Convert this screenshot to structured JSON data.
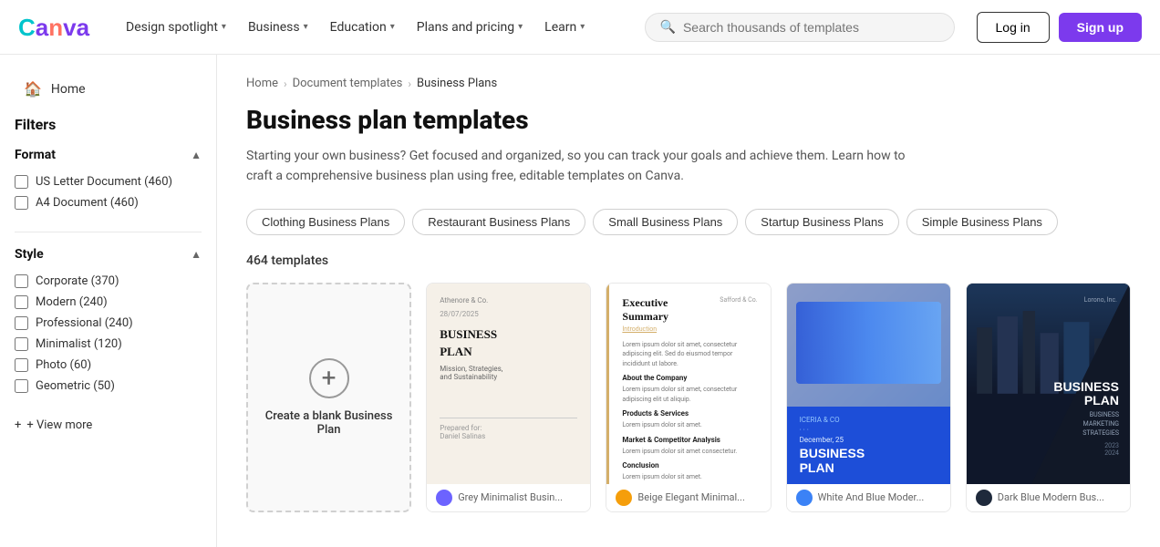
{
  "header": {
    "logo_text": "Canva",
    "nav": [
      {
        "label": "Design spotlight",
        "has_dropdown": true
      },
      {
        "label": "Business",
        "has_dropdown": true
      },
      {
        "label": "Education",
        "has_dropdown": true
      },
      {
        "label": "Plans and pricing",
        "has_dropdown": true
      },
      {
        "label": "Learn",
        "has_dropdown": true
      }
    ],
    "search_placeholder": "Search thousands of templates",
    "login_label": "Log in",
    "signup_label": "Sign up"
  },
  "sidebar": {
    "home_label": "Home",
    "filters_title": "Filters",
    "format_section": {
      "title": "Format",
      "options": [
        {
          "label": "US Letter Document (460)",
          "checked": false
        },
        {
          "label": "A4 Document (460)",
          "checked": false
        }
      ]
    },
    "style_section": {
      "title": "Style",
      "options": [
        {
          "label": "Corporate (370)",
          "checked": false
        },
        {
          "label": "Modern (240)",
          "checked": false
        },
        {
          "label": "Professional (240)",
          "checked": false
        },
        {
          "label": "Minimalist (120)",
          "checked": false
        },
        {
          "label": "Photo (60)",
          "checked": false
        },
        {
          "label": "Geometric (50)",
          "checked": false
        }
      ]
    },
    "view_more_label": "+ View more"
  },
  "content": {
    "breadcrumbs": [
      {
        "label": "Home",
        "href": "#"
      },
      {
        "label": "Document templates",
        "href": "#"
      },
      {
        "label": "Business Plans",
        "href": "#"
      }
    ],
    "page_title": "Business plan templates",
    "page_description": "Starting your own business? Get focused and organized, so you can track your goals and achieve them. Learn how to craft a comprehensive business plan using free, editable templates on Canva.",
    "category_tags": [
      "Clothing Business Plans",
      "Restaurant Business Plans",
      "Small Business Plans",
      "Startup Business Plans",
      "Simple Business Plans"
    ],
    "template_count": "464 templates",
    "blank_card": {
      "label": "Create a blank Business Plan"
    },
    "templates": [
      {
        "name": "Grey Minimalist Busin...",
        "avatar_color": "#6c63ff",
        "style": "beige",
        "company": "Athenore & Co.",
        "date": "28/07/2025",
        "title": "BUSINESS PLAN",
        "subtitle": "Mission, Strategies, and Sustainability",
        "prepared": "Prepared for: Daniel Salinas"
      },
      {
        "name": "Beige Elegant Minimal...",
        "avatar_color": "#f59e0b",
        "style": "white",
        "company": "Safford & Co.",
        "section": "Executive Summary",
        "intro": "Introduction"
      },
      {
        "name": "White And Blue Moder...",
        "avatar_color": "#3b82f6",
        "style": "blue-photo",
        "company": "ICERIA & CO",
        "date": "December, 25",
        "title": "BUSINESS PLAN"
      },
      {
        "name": "Dark Blue Modern Bus...",
        "avatar_color": "#1e293b",
        "style": "dark",
        "company": "Lorono, Inc.",
        "title": "BUSINESS PLAN",
        "subtitle": "BUSINESS MARKETING STRATEGIES",
        "year": "2023 2024"
      }
    ]
  }
}
